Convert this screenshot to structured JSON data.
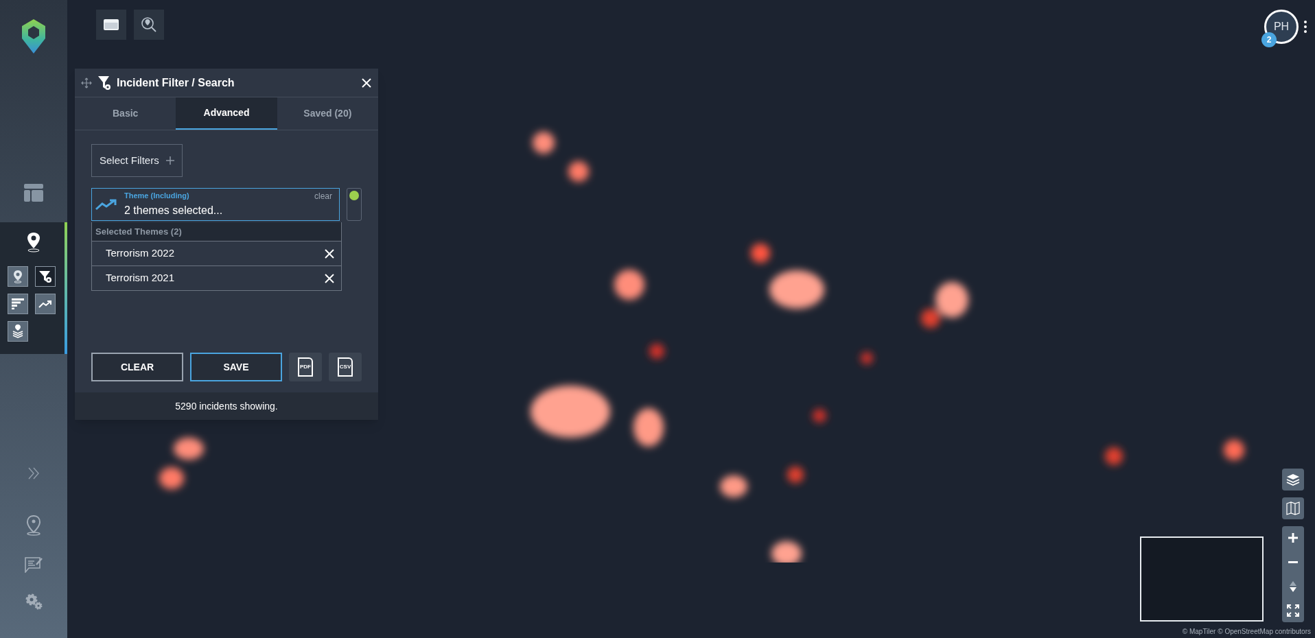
{
  "user": {
    "initials": "PH",
    "badge": "2"
  },
  "panel": {
    "title": "Incident Filter / Search",
    "tabs": [
      {
        "label": "Basic",
        "selected": false
      },
      {
        "label": "Advanced",
        "selected": true
      },
      {
        "label": "Saved (20)",
        "selected": false
      }
    ],
    "select_filters": "Select Filters",
    "theme_filter": {
      "label": "Theme (Including)",
      "value": "2 themes selected...",
      "clear": "clear",
      "on": true
    },
    "dropdown": {
      "header": "Selected Themes (2)",
      "items": [
        "Terrorism 2022",
        "Terrorism 2021"
      ]
    },
    "buttons": [
      {
        "kind": "text",
        "label": "CLEAR",
        "primary": false
      },
      {
        "kind": "text",
        "label": "SAVE",
        "primary": true
      },
      {
        "kind": "file",
        "label": "PDF"
      },
      {
        "kind": "file",
        "label": "CSV"
      }
    ],
    "status": "5290 incidents showing."
  },
  "attribution": "© MapTiler © OpenStreetMap contributors"
}
